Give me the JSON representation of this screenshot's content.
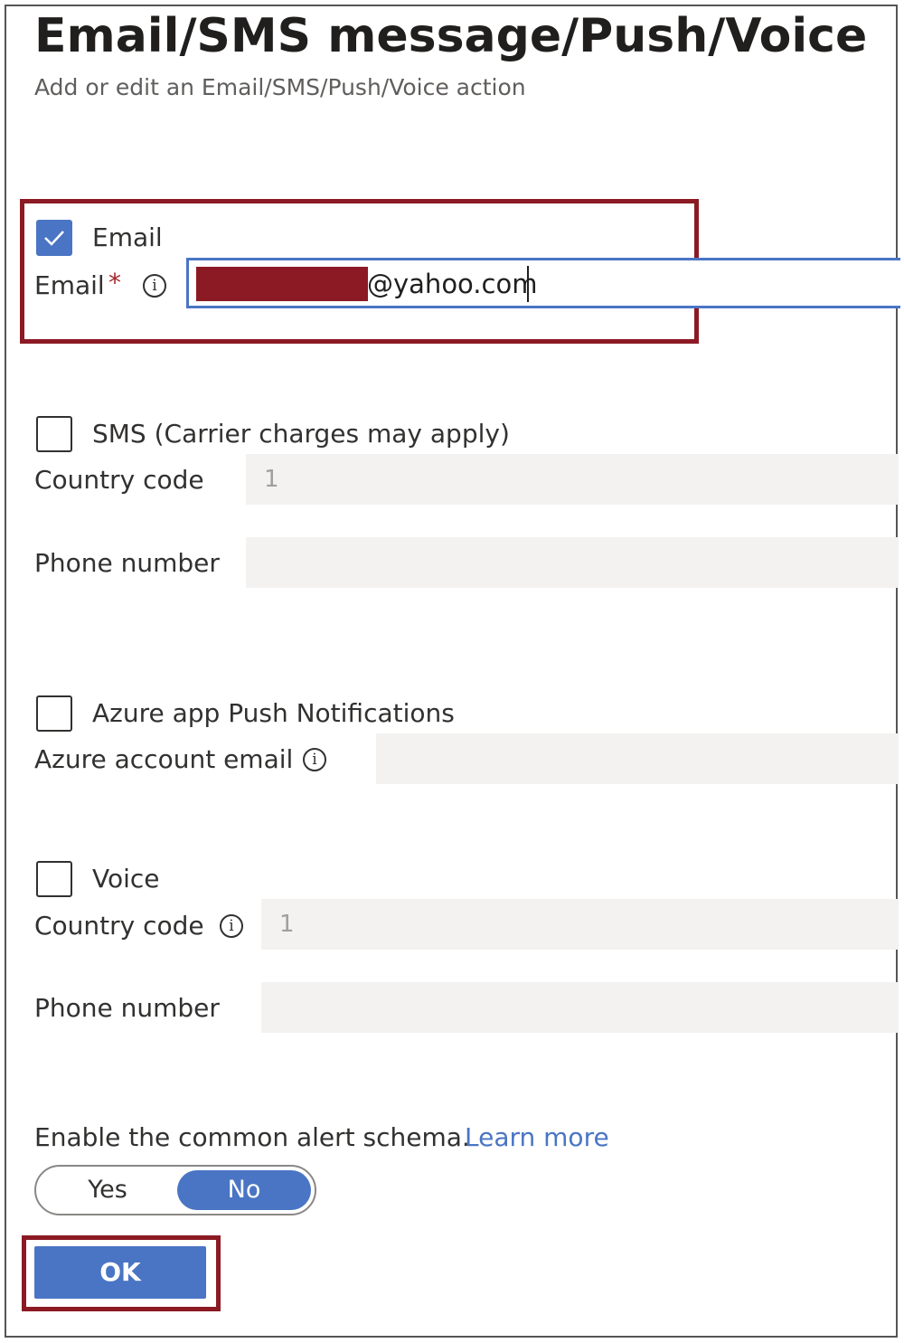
{
  "header": {
    "title": "Email/SMS message/Push/Voice",
    "subtitle": "Add or edit an Email/SMS/Push/Voice action"
  },
  "email": {
    "checkbox_label": "Email",
    "checked": true,
    "field_label": "Email",
    "required_mark": "*",
    "value_suffix": "@yahoo.com"
  },
  "sms": {
    "checkbox_label": "SMS (Carrier charges may apply)",
    "checked": false,
    "country_code_label": "Country code",
    "country_code_placeholder": "1",
    "phone_label": "Phone number"
  },
  "push": {
    "checkbox_label": "Azure app Push Notifications",
    "checked": false,
    "account_label": "Azure account email"
  },
  "voice": {
    "checkbox_label": "Voice",
    "checked": false,
    "country_code_label": "Country code",
    "country_code_placeholder": "1",
    "phone_label": "Phone number"
  },
  "schema": {
    "label": "Enable the common alert schema.",
    "link": "Learn more",
    "yes": "Yes",
    "no": "No",
    "selected": "No"
  },
  "footer": {
    "ok_label": "OK"
  },
  "colors": {
    "accent": "#4a75c4",
    "highlight": "#8b1a24"
  }
}
